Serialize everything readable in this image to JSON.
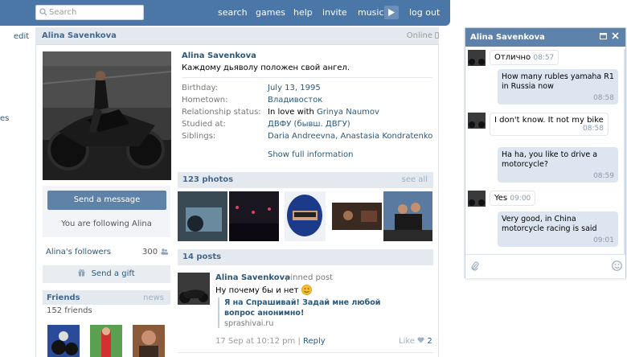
{
  "topbar": {
    "search_placeholder": "Search",
    "nav": [
      "search",
      "games",
      "help",
      "invite",
      "music",
      "log out"
    ]
  },
  "left": {
    "edit": "edit",
    "fragment": "es"
  },
  "profile": {
    "name": "Alina Savenkova",
    "online": "Online",
    "status": "Каждому дьяволу положен свой ангел.",
    "info": [
      {
        "label": "Birthday:",
        "value": "July 13, 1995"
      },
      {
        "label": "Hometown:",
        "value": "Владивосток"
      },
      {
        "label": "Relationship status:",
        "prefix": "In love with ",
        "value": "Grinya Naumov"
      },
      {
        "label": "Studied at:",
        "value": "ДВФУ (бывш. ДВГУ)"
      },
      {
        "label": "Siblings:",
        "value": "Daria Andreevna, Anastasia Kondratenko"
      }
    ],
    "show_full": "Show full information",
    "send_message": "Send a message",
    "following": "You are following Alina",
    "followers_label": "Alina's followers",
    "followers_count": "300",
    "send_gift": "Send a gift",
    "friends_title": "Friends",
    "friends_news": "news",
    "friends_count": "152 friends"
  },
  "photos": {
    "title": "123 photos",
    "see_all": "see all"
  },
  "posts": {
    "title": "14 posts",
    "items": [
      {
        "author": "Alina Savenkova",
        "pinned": "pinned post",
        "text": "Ну почему бы и нет",
        "quote_title": "Я на Спрашивай! Задай мне любой вопрос анонимно!",
        "quote_source": "sprashivai.ru",
        "date": "17 Sep at 10:12 pm",
        "sep": "|",
        "reply": "Reply",
        "like_label": "Like",
        "like_count": "2"
      }
    ]
  },
  "chat": {
    "title": "Alina Savenkova",
    "messages": [
      {
        "dir": "in",
        "text": "Отлично",
        "time": "08:57"
      },
      {
        "dir": "out",
        "text": "How many rubles yamaha R1 in Russia now",
        "time": "08:58"
      },
      {
        "dir": "in",
        "text": "I don't know. It not my bike",
        "time": "08:58"
      },
      {
        "dir": "out",
        "text": "Ha ha, you like to drive a motorcycle?",
        "time": "08:59"
      },
      {
        "dir": "in",
        "text": "Yes",
        "time": "09:00"
      },
      {
        "dir": "out",
        "text": "Very good, in China motorcycle racing is said",
        "time": "09:01"
      }
    ]
  },
  "colors": {
    "brand": "#4a76a8",
    "link": "#2b587a",
    "header_bg": "#e3e9ef",
    "bubble_out": "#dde6f0"
  }
}
